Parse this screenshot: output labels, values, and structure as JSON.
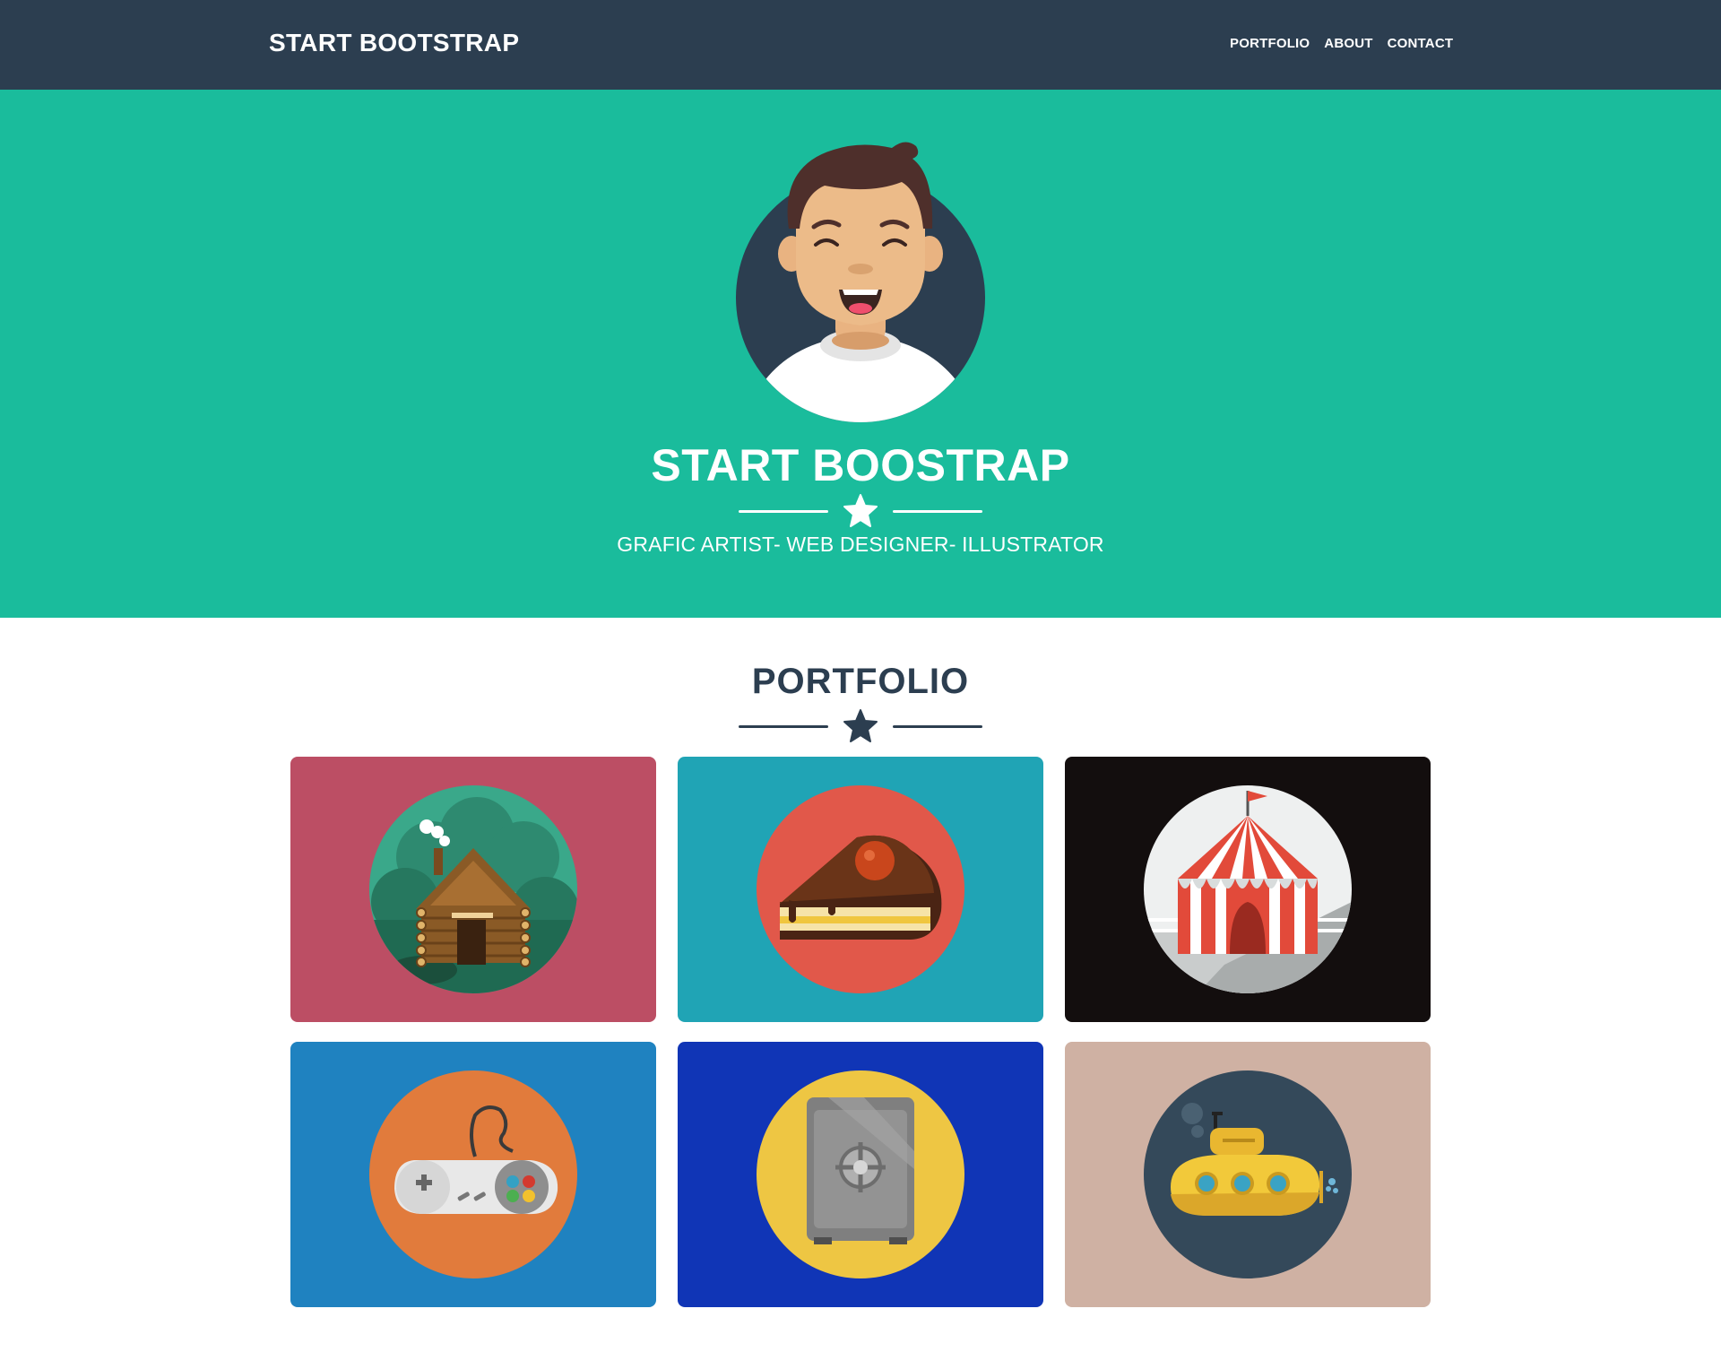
{
  "navbar": {
    "brand": "START BOOTSTRAP",
    "links": [
      {
        "label": "PORTFOLIO"
      },
      {
        "label": "ABOUT"
      },
      {
        "label": "CONTACT"
      }
    ],
    "background": "#2c3e50"
  },
  "masthead": {
    "title": "START BOOSTRAP",
    "subtitle": "GRAFIC ARTIST- WEB DESIGNER- ILLUSTRATOR",
    "background": "#1abc9c",
    "avatar_icon": "smiling-man-avatar-icon",
    "divider_icon": "star-icon"
  },
  "portfolio": {
    "heading": "PORTFOLIO",
    "divider_icon": "star-icon",
    "items": [
      {
        "icon": "log-cabin-icon",
        "background": "#bc4e64",
        "circle": "#3aa88a"
      },
      {
        "icon": "cake-slice-icon",
        "background": "#20a4b5",
        "circle": "#e1584a"
      },
      {
        "icon": "circus-tent-icon",
        "background": "#130e0e",
        "circle": "#eef0f0"
      },
      {
        "icon": "game-controller-icon",
        "background": "#1f82c0",
        "circle": "#e17b3c"
      },
      {
        "icon": "safe-icon",
        "background": "#1035b6",
        "circle": "#eec643"
      },
      {
        "icon": "submarine-icon",
        "background": "#cfb1a3",
        "circle": "#34495a"
      }
    ]
  }
}
